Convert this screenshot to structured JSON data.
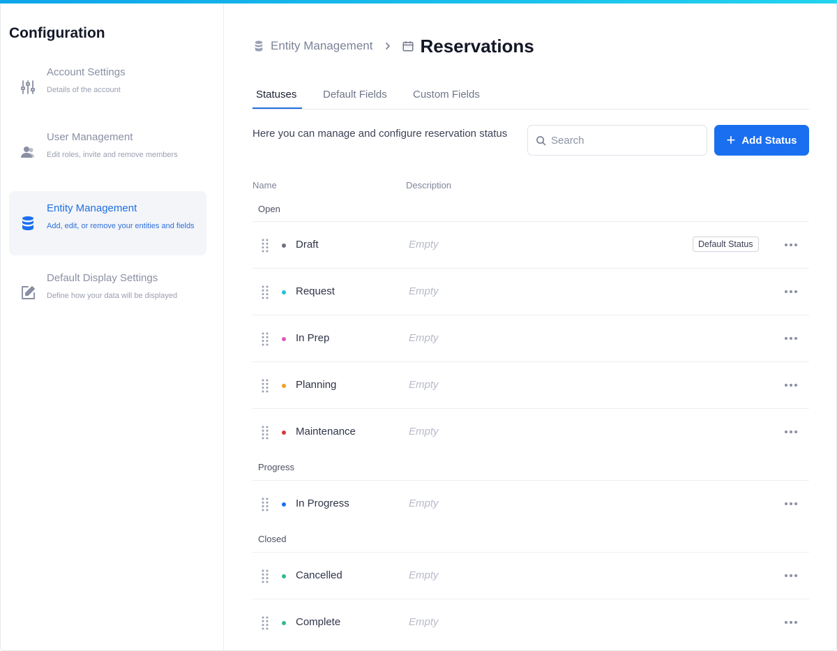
{
  "sidebar": {
    "title": "Configuration",
    "items": [
      {
        "label": "Account Settings",
        "description": "Details of the account",
        "icon": "sliders-icon"
      },
      {
        "label": "User Management",
        "description": "Edit roles, invite and remove members",
        "icon": "users-icon"
      },
      {
        "label": "Entity Management",
        "description": "Add, edit, or remove your entities and fields",
        "icon": "database-icon",
        "active": true
      },
      {
        "label": "Default Display Settings",
        "description": "Define how your data will be displayed",
        "icon": "edit-icon"
      }
    ]
  },
  "breadcrumb": {
    "parent": "Entity Management",
    "parent_icon": "database-icon",
    "current": "Reservations",
    "current_icon": "calendar-icon"
  },
  "tabs": [
    {
      "label": "Statuses",
      "active": true
    },
    {
      "label": "Default Fields"
    },
    {
      "label": "Custom Fields"
    }
  ],
  "intro": "Here you can manage and configure reservation status",
  "search": {
    "placeholder": "Search",
    "value": ""
  },
  "add_button": {
    "label": "Add Status",
    "icon": "plus-icon"
  },
  "table": {
    "columns": {
      "name": "Name",
      "description": "Description"
    },
    "groups": [
      {
        "label": "Open",
        "rows": [
          {
            "name": "Draft",
            "description": "Empty",
            "color": "#6b7080",
            "badge": "Default Status"
          },
          {
            "name": "Request",
            "description": "Empty",
            "color": "#22c3d3"
          },
          {
            "name": "In Prep",
            "description": "Empty",
            "color": "#e058c4"
          },
          {
            "name": "Planning",
            "description": "Empty",
            "color": "#f0a020"
          },
          {
            "name": "Maintenance",
            "description": "Empty",
            "color": "#d63b3b"
          }
        ]
      },
      {
        "label": "Progress",
        "rows": [
          {
            "name": "In Progress",
            "description": "Empty",
            "color": "#1a6ff0"
          }
        ]
      },
      {
        "label": "Closed",
        "rows": [
          {
            "name": "Cancelled",
            "description": "Empty",
            "color": "#34b98a"
          },
          {
            "name": "Complete",
            "description": "Empty",
            "color": "#34b98a"
          }
        ]
      }
    ]
  },
  "colors": {
    "accent": "#1a6ff0",
    "active_nav_bg": "#f3f5f9"
  }
}
